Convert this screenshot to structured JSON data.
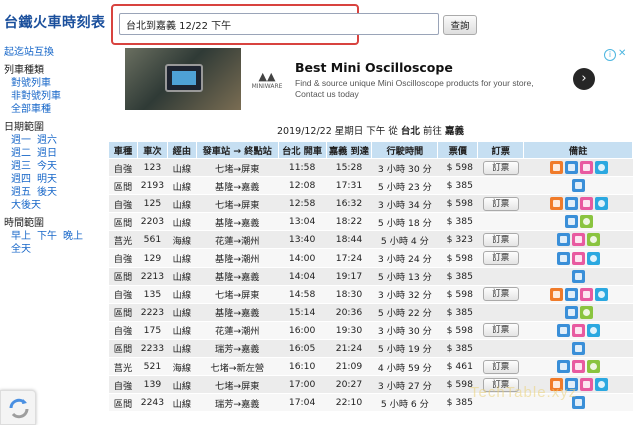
{
  "site_title": "台鐵火車時刻表",
  "search": {
    "value": "台北到嘉義 12/22 下午",
    "button_label": "查詢"
  },
  "sidebar": {
    "swap": "起迄站互換",
    "train_type_title": "列車種類",
    "train_types": [
      "對號列車",
      "非對號列車",
      "全部車種"
    ],
    "date_range_title": "日期範圍",
    "date_rows": [
      [
        "週一",
        "週六"
      ],
      [
        "週二",
        "週日"
      ],
      [
        "週三",
        "今天"
      ],
      [
        "週四",
        "明天"
      ],
      [
        "週五",
        "後天"
      ],
      [
        "大後天"
      ]
    ],
    "time_range_title": "時間範圍",
    "time_rows": [
      [
        "早上",
        "下午",
        "晚上"
      ],
      [
        "全天"
      ]
    ]
  },
  "ad": {
    "title": "Best Mini Oscilloscope",
    "description": "Find & source unique Mini Oscilloscope products for your store, Contact us today",
    "brand": "MINIWARE",
    "info_icon": "info-icon",
    "close_icon": "close-icon",
    "arrow_icon": "chevron-right-icon"
  },
  "date_line": {
    "prefix": "2019/12/22 星期日 下午 從",
    "from": "台北",
    "mid": "前往",
    "to": "嘉義"
  },
  "table": {
    "headers": [
      "車種",
      "車次",
      "經由",
      "發車站 → 終點站",
      "台北 開車",
      "嘉義 到達",
      "行駛時間",
      "票價",
      "訂票",
      "備註"
    ],
    "rows": [
      {
        "type": "自強",
        "no": "123",
        "via": "山線",
        "route": "七堵→屏東",
        "dep": "11:58",
        "arr": "15:28",
        "dur": "3 小時 30 分",
        "price": "$ 598",
        "book": "訂票",
        "notes": [
          "food",
          "bus",
          "family",
          "wheel"
        ]
      },
      {
        "type": "區間",
        "no": "2193",
        "via": "山線",
        "route": "基隆→嘉義",
        "dep": "12:08",
        "arr": "17:31",
        "dur": "5 小時 23 分",
        "price": "$ 385",
        "book": "",
        "notes": [
          "bus"
        ]
      },
      {
        "type": "自強",
        "no": "125",
        "via": "山線",
        "route": "七堵→屏東",
        "dep": "12:58",
        "arr": "16:32",
        "dur": "3 小時 34 分",
        "price": "$ 598",
        "book": "訂票",
        "notes": [
          "food",
          "bus",
          "family",
          "wheel"
        ]
      },
      {
        "type": "區間",
        "no": "2203",
        "via": "山線",
        "route": "基隆→嘉義",
        "dep": "13:04",
        "arr": "18:22",
        "dur": "5 小時 18 分",
        "price": "$ 385",
        "book": "",
        "notes": [
          "bus",
          "bike"
        ]
      },
      {
        "type": "莒光",
        "no": "561",
        "via": "海線",
        "route": "花蓮→潮州",
        "dep": "13:40",
        "arr": "18:44",
        "dur": "5 小時 4 分",
        "price": "$ 323",
        "book": "訂票",
        "notes": [
          "bus",
          "family",
          "bike"
        ]
      },
      {
        "type": "自強",
        "no": "129",
        "via": "山線",
        "route": "基隆→潮州",
        "dep": "14:00",
        "arr": "17:24",
        "dur": "3 小時 24 分",
        "price": "$ 598",
        "book": "訂票",
        "notes": [
          "bus",
          "family",
          "wheel"
        ]
      },
      {
        "type": "區間",
        "no": "2213",
        "via": "山線",
        "route": "基隆→嘉義",
        "dep": "14:04",
        "arr": "19:17",
        "dur": "5 小時 13 分",
        "price": "$ 385",
        "book": "",
        "notes": [
          "bus"
        ]
      },
      {
        "type": "自強",
        "no": "135",
        "via": "山線",
        "route": "七堵→屏東",
        "dep": "14:58",
        "arr": "18:30",
        "dur": "3 小時 32 分",
        "price": "$ 598",
        "book": "訂票",
        "notes": [
          "food",
          "bus",
          "family",
          "wheel"
        ]
      },
      {
        "type": "區間",
        "no": "2223",
        "via": "山線",
        "route": "基隆→嘉義",
        "dep": "15:14",
        "arr": "20:36",
        "dur": "5 小時 22 分",
        "price": "$ 385",
        "book": "",
        "notes": [
          "bus",
          "bike"
        ]
      },
      {
        "type": "自強",
        "no": "175",
        "via": "山線",
        "route": "花蓮→潮州",
        "dep": "16:00",
        "arr": "19:30",
        "dur": "3 小時 30 分",
        "price": "$ 598",
        "book": "訂票",
        "notes": [
          "bus",
          "family",
          "wheel"
        ]
      },
      {
        "type": "區間",
        "no": "2233",
        "via": "山線",
        "route": "瑞芳→嘉義",
        "dep": "16:05",
        "arr": "21:24",
        "dur": "5 小時 19 分",
        "price": "$ 385",
        "book": "",
        "notes": [
          "bus"
        ]
      },
      {
        "type": "莒光",
        "no": "521",
        "via": "海線",
        "route": "七堵→新左營",
        "dep": "16:10",
        "arr": "21:09",
        "dur": "4 小時 59 分",
        "price": "$ 461",
        "book": "訂票",
        "notes": [
          "bus",
          "family",
          "bike"
        ]
      },
      {
        "type": "自強",
        "no": "139",
        "via": "山線",
        "route": "七堵→屏東",
        "dep": "17:00",
        "arr": "20:27",
        "dur": "3 小時 27 分",
        "price": "$ 598",
        "book": "訂票",
        "notes": [
          "food",
          "bus",
          "family",
          "wheel"
        ]
      },
      {
        "type": "區間",
        "no": "2243",
        "via": "山線",
        "route": "瑞芳→嘉義",
        "dep": "17:04",
        "arr": "22:10",
        "dur": "5 小時 6 分",
        "price": "$ 385",
        "book": "",
        "notes": [
          "bus"
        ]
      }
    ]
  },
  "watermark": "TechTable.xyz"
}
